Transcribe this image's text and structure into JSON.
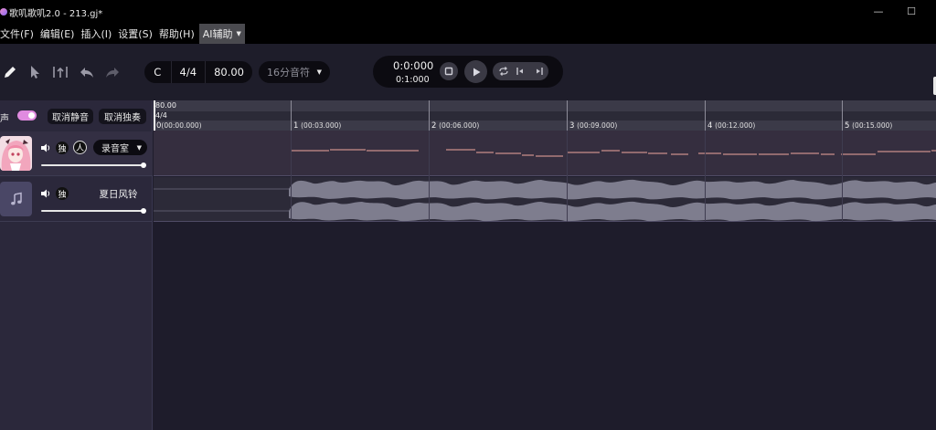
{
  "window": {
    "title": "歌叽歌叽2.0 - 213.gj*",
    "minimize_glyph": "—",
    "maximize_glyph": "☐"
  },
  "menu": {
    "items": [
      "文件(F)",
      "编辑(E)",
      "插入(I)",
      "设置(S)",
      "帮助(H)"
    ],
    "ai_label": "AI辅助"
  },
  "toolbar": {
    "tools": [
      "pencil-icon",
      "pointer-icon",
      "split-icon",
      "undo-icon",
      "redo-icon"
    ],
    "key": "C",
    "time_signature": "4/4",
    "tempo": "80.00",
    "note_division": "16分音符"
  },
  "transport": {
    "time": "0:0:000",
    "bar_position": "0:1:000",
    "buttons": [
      "stop-icon",
      "play-icon",
      "loop-icon",
      "go-to-start-icon",
      "go-to-end-icon"
    ]
  },
  "track_panel": {
    "human_voice_label": "人声",
    "human_voice_enabled": true,
    "unmute_all_label": "取消静音",
    "unsolo_all_label": "取消独奏",
    "tracks": [
      {
        "type": "vocal",
        "solo_label": "独",
        "person_label": "人",
        "singer_style": "录音室",
        "volume": 1.0
      },
      {
        "type": "audio",
        "solo_label": "独",
        "name": "夏日风铃",
        "volume": 1.0
      }
    ]
  },
  "timeline": {
    "tempo_marker": "80.00",
    "signature_marker": "4/4",
    "bars": [
      {
        "bar": "0",
        "time": "(00:00.000)"
      },
      {
        "bar": "1",
        "time": "(00:03.000)"
      },
      {
        "bar": "2",
        "time": "(00:06.000)"
      },
      {
        "bar": "3",
        "time": "(00:09.000)"
      },
      {
        "bar": "4",
        "time": "(00:12.000)"
      },
      {
        "bar": "5",
        "time": "(00:15.000)"
      }
    ]
  },
  "colors": {
    "accent_pink": "#e08be0",
    "note_line": "#c98e8a",
    "waveform": "#7e7d8e",
    "panel": "#2b283b",
    "background": "#1e1c2b"
  }
}
